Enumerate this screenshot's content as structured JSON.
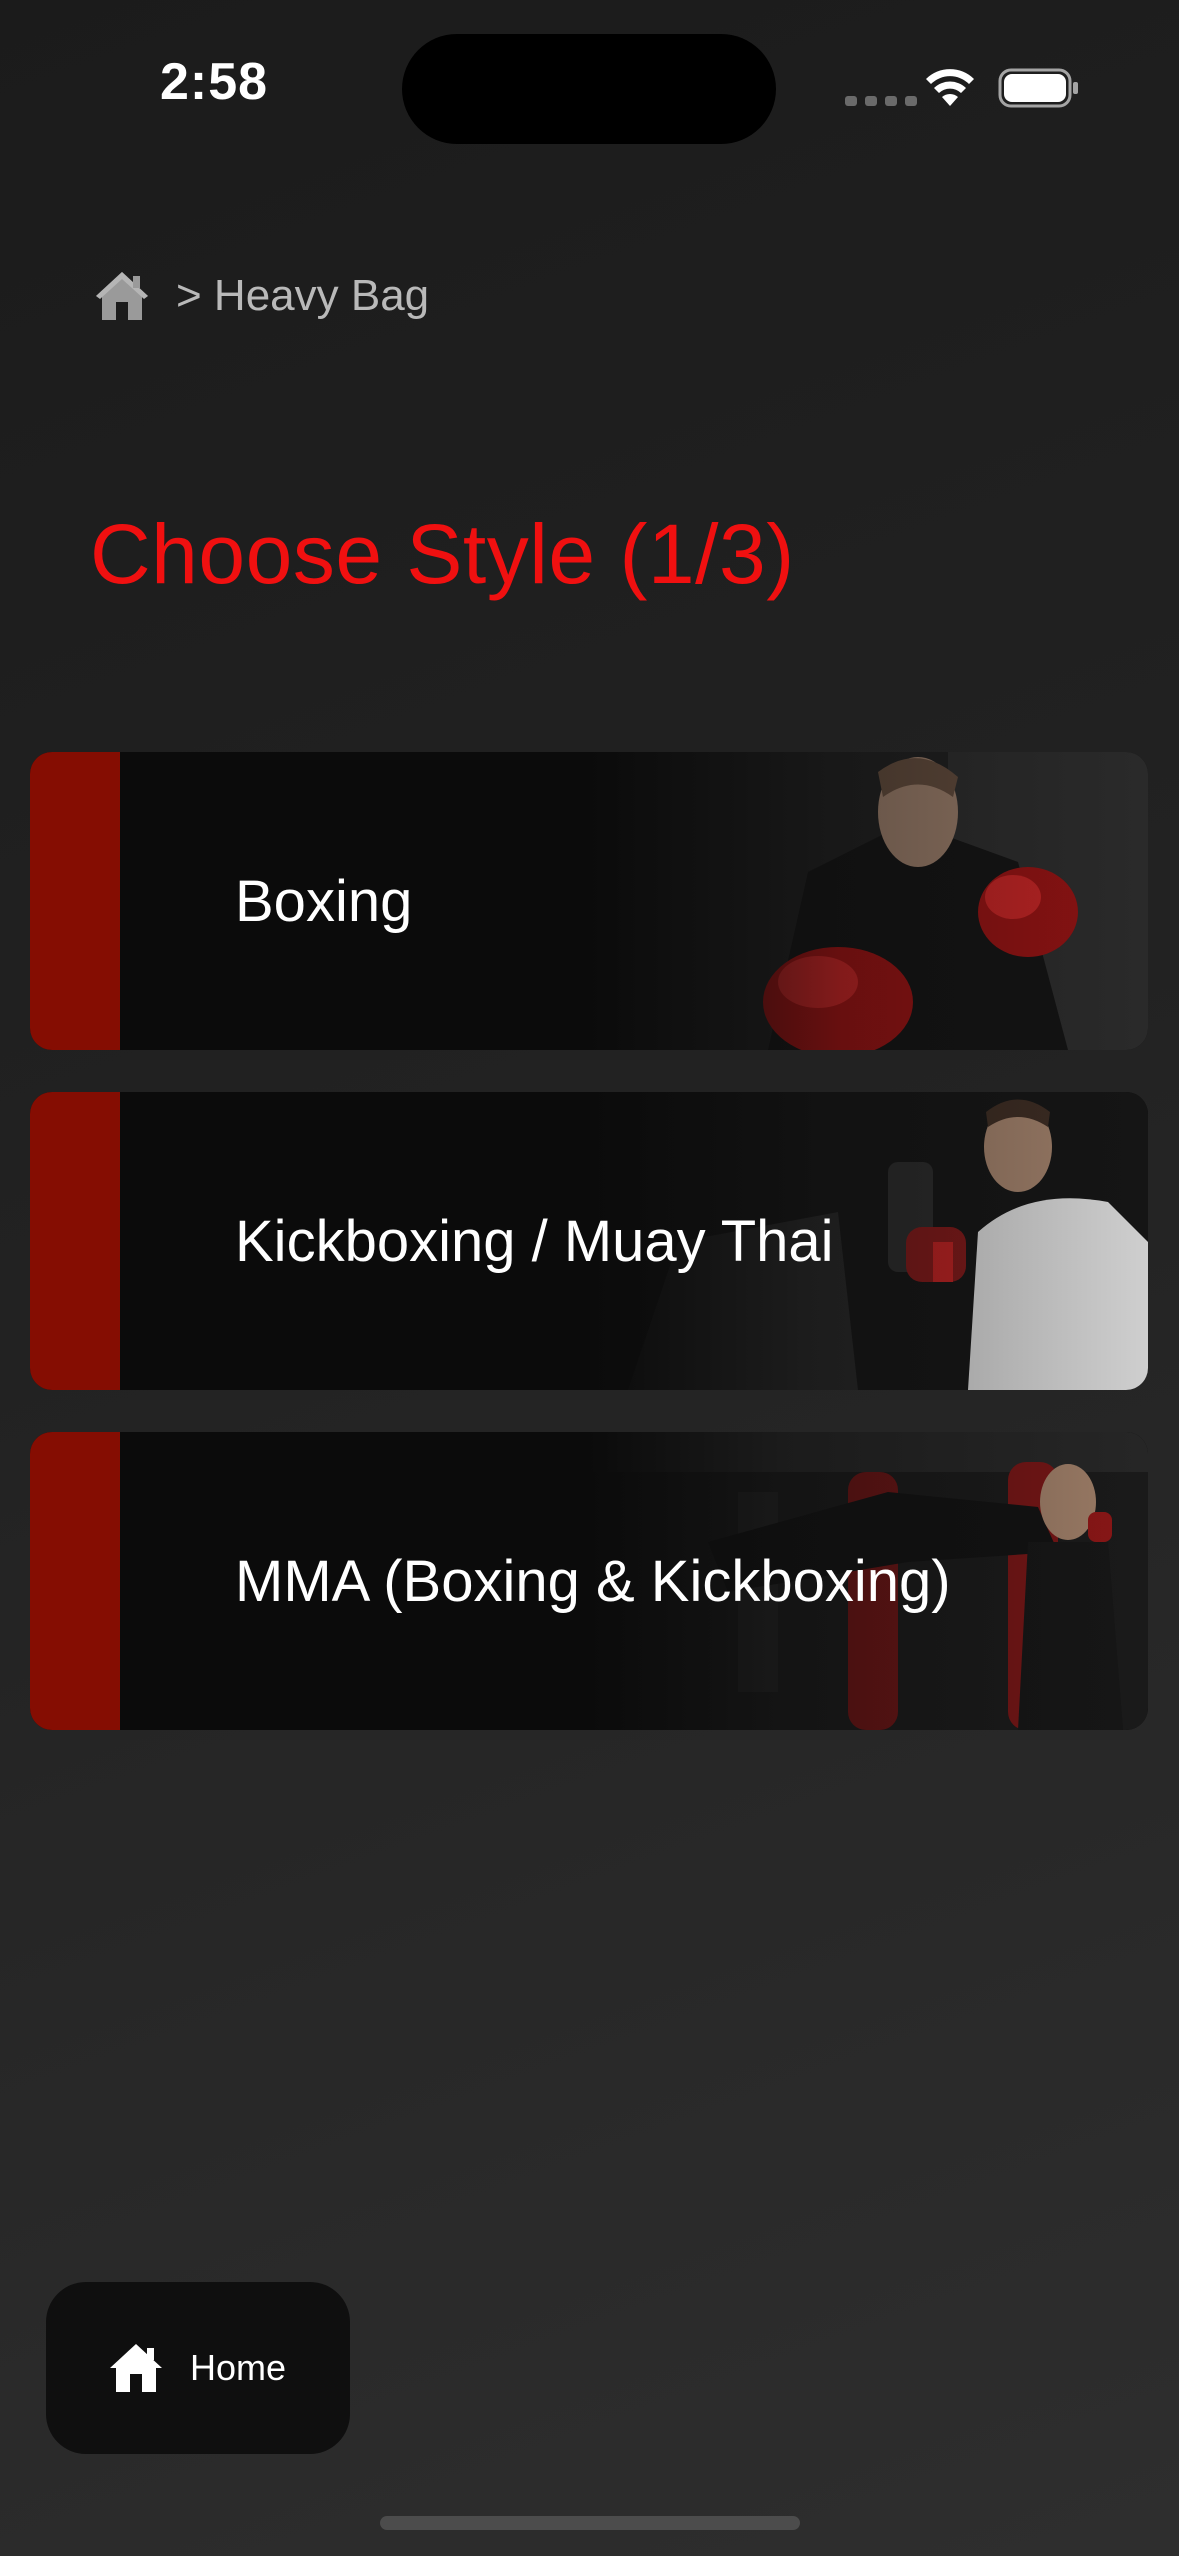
{
  "status_bar": {
    "time": "2:58"
  },
  "breadcrumb": {
    "home_icon": "house-icon",
    "text": "> Heavy Bag"
  },
  "page": {
    "title": "Choose Style (1/3)"
  },
  "styles": [
    {
      "label": "Boxing"
    },
    {
      "label": "Kickboxing / Muay Thai"
    },
    {
      "label": "MMA (Boxing & Kickboxing)"
    }
  ],
  "bottom_nav": {
    "home_label": "Home",
    "home_icon": "house-icon"
  },
  "colors": {
    "accent_red": "#f01010",
    "card_bar_red": "#850d02",
    "card_bg": "#0b0b0b"
  }
}
